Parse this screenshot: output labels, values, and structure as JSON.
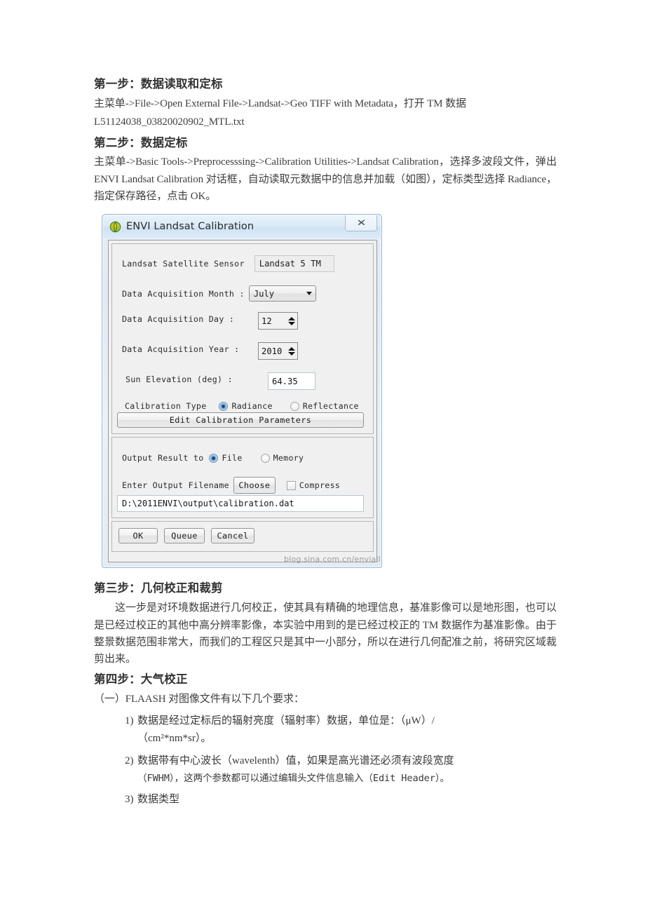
{
  "document": {
    "sections": [
      {
        "heading": "第一步：数据读取和定标",
        "paragraphs": [
          "主菜单->File->Open External File->Landsat->Geo TIFF with Metadata，打开 TM 数据",
          "L51124038_03820020902_MTL.txt"
        ]
      },
      {
        "heading": "第二步：数据定标",
        "paragraphs": [
          "主菜单->Basic Tools->Preprocesssing->Calibration Utilities->Landsat Calibration，选择多波段文件，弹出 ENVI Landsat Calibration 对话框，自动读取元数据中的信息并加载（如图），定标类型选择 Radiance，指定保存路径，点击 OK。"
        ]
      },
      {
        "heading": "第三步：几何校正和裁剪",
        "paragraphs": [
          "这一步是对环境数据进行几何校正，使其具有精确的地理信息，基准影像可以是地形图，也可以是已经过校正的其他中高分辨率影像，本实验中用到的是已经过校正的 TM 数据作为基准影像。由于整景数据范围非常大，而我们的工程区只是其中一小部分，所以在进行几何配准之前，将研究区域裁剪出来。"
        ]
      },
      {
        "heading": "第四步：大气校正",
        "paragraphs": [
          "（一）FLAASH 对图像文件有以下几个要求："
        ]
      }
    ],
    "requirements": [
      {
        "number": "1)",
        "text": "数据是经过定标后的辐射亮度（辐射率）数据，单位是：（μW）/",
        "continuation": "（cm²*nm*sr）。"
      },
      {
        "number": "2)",
        "text": "数据带有中心波长（wavelenth）值，如果是高光谱还必须有波段宽度",
        "continuation": "（FWHM），这两个参数都可以通过编辑头文件信息输入（Edit Header）。"
      },
      {
        "number": "3)",
        "text": "数据类型",
        "continuation": ""
      }
    ]
  },
  "dialog": {
    "title": "ENVI Landsat Calibration",
    "icon": "envi-globe-icon",
    "close_label": "✕",
    "fields": {
      "sensor_label": "Landsat Satellite Sensor",
      "sensor_value": "Landsat 5 TM",
      "month_label": "Data Acquisition Month :",
      "month_value": "July",
      "day_label": "Data Acquisition Day :",
      "day_value": "12",
      "year_label": "Data Acquisition Year :",
      "year_value": "2010",
      "sun_elevation_label": "Sun Elevation (deg) :",
      "sun_elevation_value": "64.35",
      "calibration_type_label": "Calibration Type",
      "radiance_label": "Radiance",
      "reflectance_label": "Reflectance",
      "calibration_type_selected": "Radiance",
      "edit_params_label": "Edit Calibration Parameters"
    },
    "output": {
      "output_to_label": "Output Result to",
      "file_label": "File",
      "memory_label": "Memory",
      "output_selected": "File",
      "filename_label": "Enter Output Filename",
      "choose_label": "Choose",
      "compress_label": "Compress",
      "compress_checked": false,
      "path_value": "D:\\2011ENVI\\output\\calibration.dat"
    },
    "buttons": {
      "ok": "OK",
      "queue": "Queue",
      "cancel": "Cancel"
    },
    "colors": {
      "titlebar": "#dcebf7",
      "radio_selected": "#1b3f6e",
      "panel_bg": "#f0f0f0"
    }
  },
  "watermark": "blog.sina.com.cn/enviall"
}
